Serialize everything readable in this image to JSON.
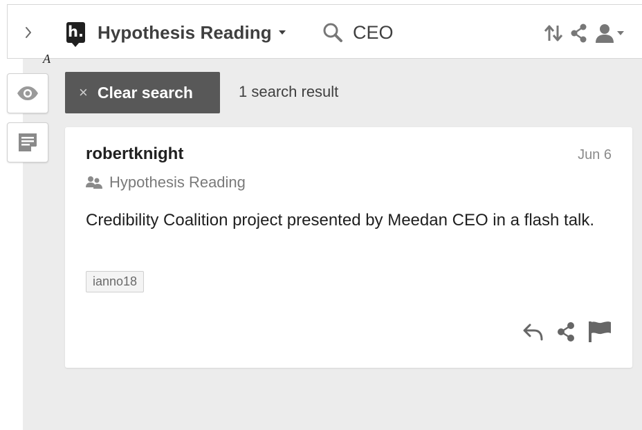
{
  "topbar": {
    "brand_name": "Hypothesis Reading",
    "brand_logo_text": "h.",
    "search_value": "CEO"
  },
  "page": {
    "glyph": "A"
  },
  "search_status": {
    "clear_label": "Clear search",
    "clear_icon": "×",
    "result_count": "1 search result"
  },
  "annotation": {
    "user": "robertknight",
    "date": "Jun 6",
    "group": "Hypothesis Reading",
    "text": "Credibility Coalition project presented by Meedan CEO in a flash talk.",
    "tags": [
      "ianno18"
    ]
  },
  "icons": {
    "sidebar_toggle": "chevron-right-icon",
    "search": "search-icon",
    "sort": "sort-icon",
    "share": "share-icon",
    "user": "user-icon",
    "eye": "eye-icon",
    "notes": "page-notes-icon",
    "group": "group-icon",
    "reply": "reply-icon",
    "flag": "flag-icon"
  },
  "colors": {
    "sidebar_background": "#ececec",
    "clear_button": "#585858",
    "text_dark": "#202020",
    "text_muted": "#7a7a7a",
    "icon_gray": "#777777"
  }
}
